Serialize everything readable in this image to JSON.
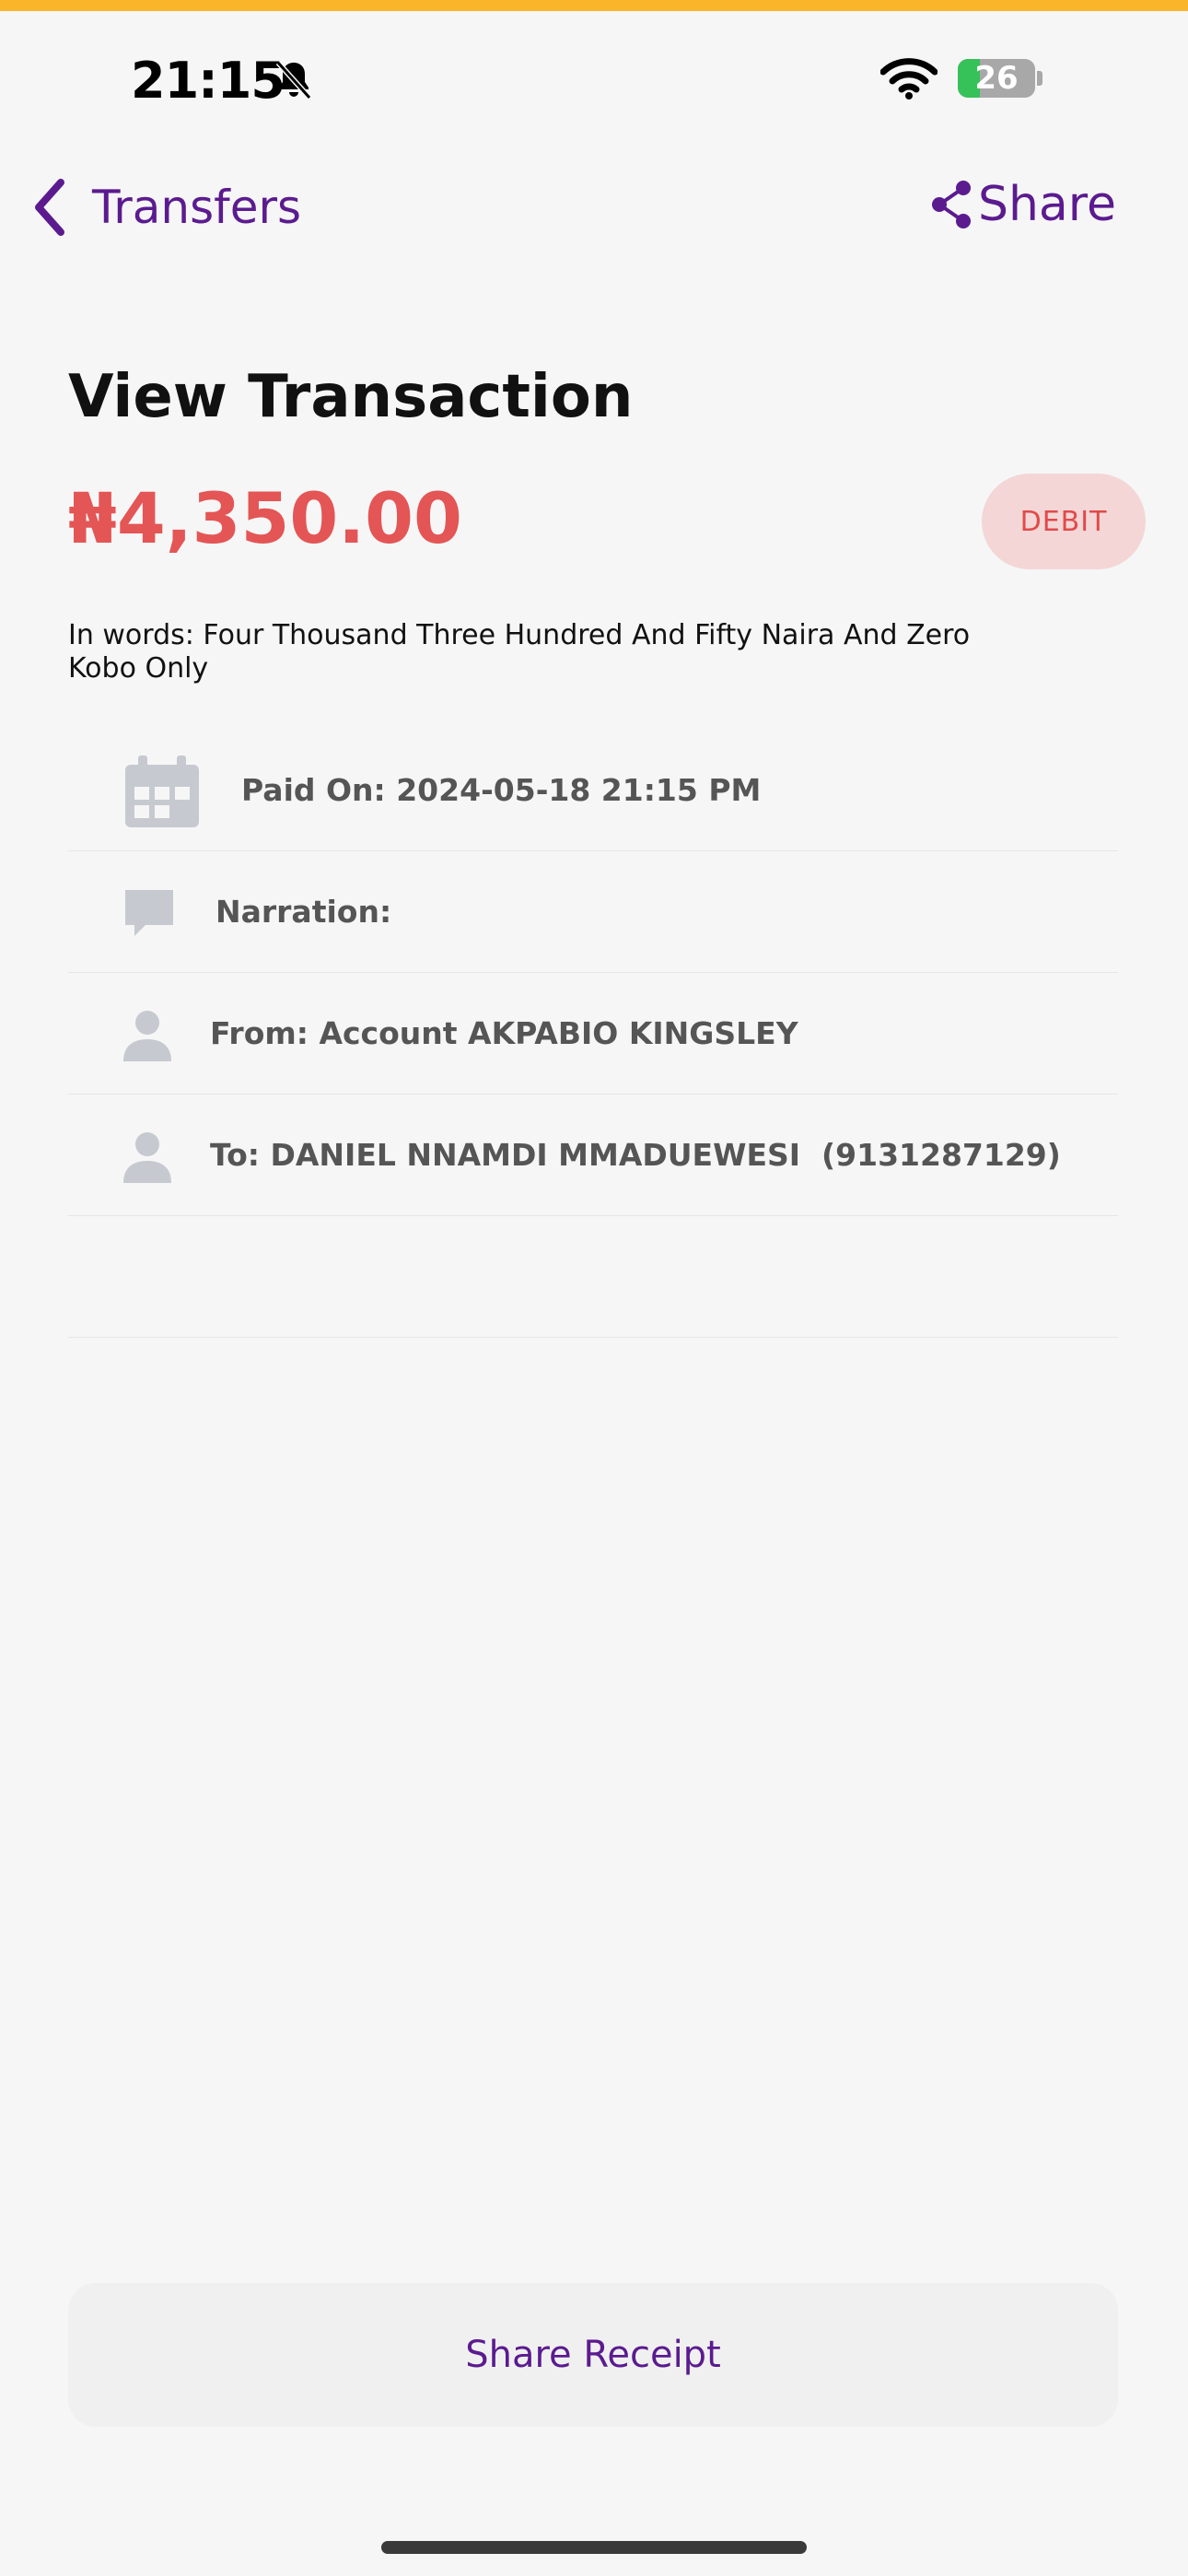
{
  "status_bar": {
    "time": "21:15",
    "battery": "26",
    "icons": [
      "bell-slash-icon",
      "wifi-icon",
      "battery-charging-icon"
    ]
  },
  "nav": {
    "back_label": "Transfers",
    "share_label": "Share"
  },
  "page_title": "View Transaction",
  "transaction": {
    "amount": "₦4,350.00",
    "type_badge": "DEBIT",
    "in_words": "In words: Four Thousand Three Hundred And Fifty Naira And Zero Kobo Only",
    "paid_on": "Paid On: 2024-05-18 21:15 PM",
    "narration": "Narration:",
    "from": "From: Account AKPABIO KINGSLEY",
    "to": "To: DANIEL NNAMDI MMADUEWESI  (9131287129)"
  },
  "actions": {
    "share_receipt": "Share Receipt"
  },
  "colors": {
    "accent": "#5b1b8f",
    "debit": "#e45555",
    "top_bar": "#fbb52b"
  }
}
